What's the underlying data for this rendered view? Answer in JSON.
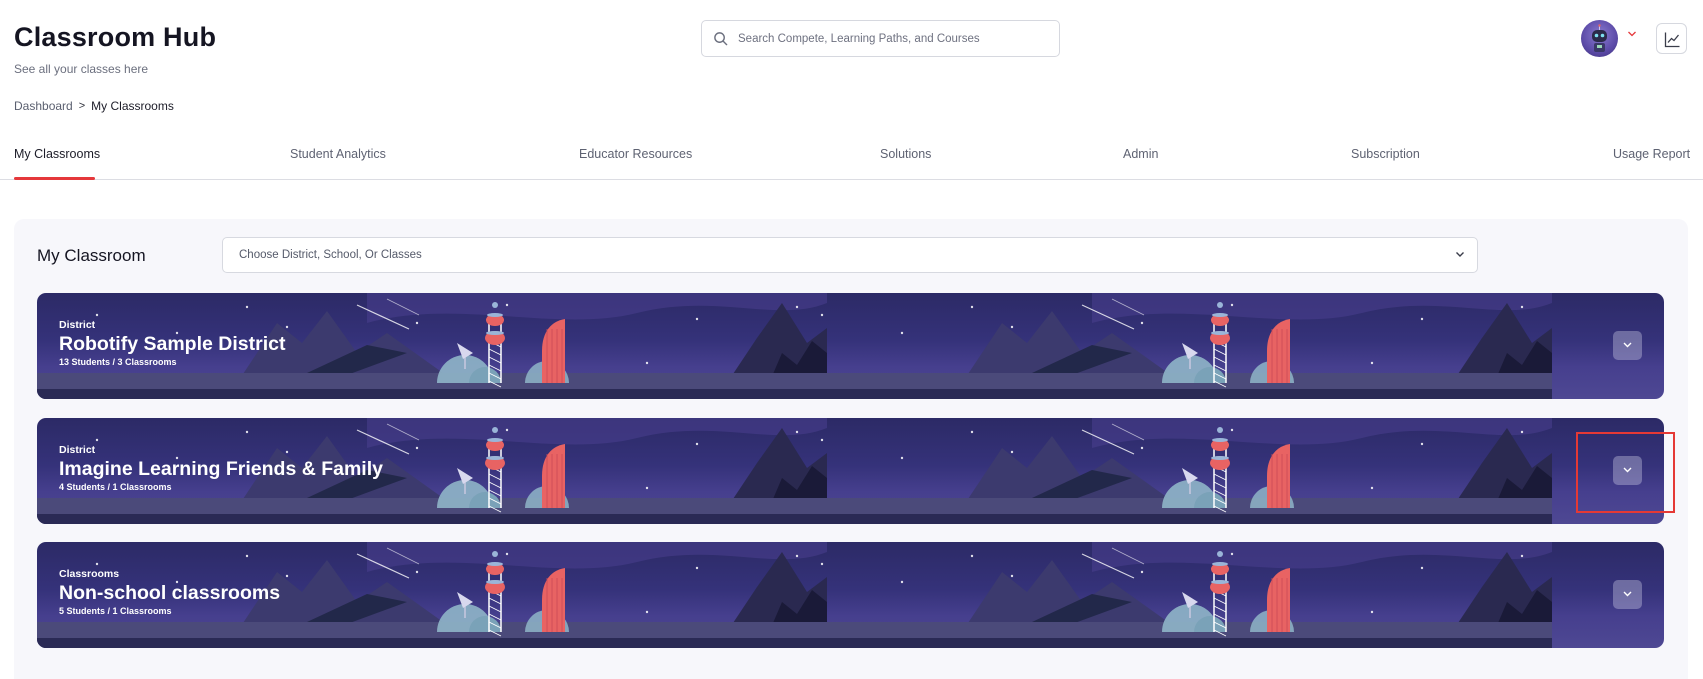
{
  "header": {
    "title": "Classroom Hub",
    "subtitle": "See all your classes here"
  },
  "search": {
    "placeholder": "Search Compete, Learning Paths, and Courses"
  },
  "breadcrumb": {
    "items": [
      "Dashboard",
      "My Classrooms"
    ],
    "separator": ">"
  },
  "tabs": [
    {
      "label": "My Classrooms",
      "active": true
    },
    {
      "label": "Student Analytics",
      "active": false
    },
    {
      "label": "Educator Resources",
      "active": false
    },
    {
      "label": "Solutions",
      "active": false
    },
    {
      "label": "Admin",
      "active": false
    },
    {
      "label": "Subscription",
      "active": false
    },
    {
      "label": "Usage Report",
      "active": false
    }
  ],
  "main": {
    "section_title": "My Classroom",
    "filter_placeholder": "Choose District, School, Or Classes",
    "groups": [
      {
        "kind": "District",
        "name": "Robotify Sample District",
        "meta": "13 Students / 3 Classrooms"
      },
      {
        "kind": "District",
        "name": "Imagine Learning Friends & Family",
        "meta": "4 Students / 1 Classrooms"
      },
      {
        "kind": "Classrooms",
        "name": "Non-school classrooms",
        "meta": "5 Students / 1 Classrooms"
      }
    ]
  },
  "icons": {
    "search": "search-icon",
    "avatar_caret": "chevron-down-icon",
    "analytics": "line-chart-icon",
    "expand": "chevron-down-icon"
  },
  "colors": {
    "accent": "#e5383b",
    "banner_bg": "#35327a",
    "tower_red": "#e86363",
    "dome": "#8fb5c8"
  }
}
